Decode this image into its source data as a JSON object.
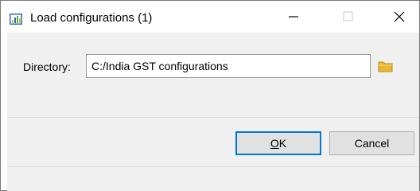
{
  "window": {
    "title": "Load configurations (1)",
    "icon": "app-icon"
  },
  "titlebar_buttons": {
    "minimize": "minimize-icon",
    "maximize": "maximize-icon",
    "close": "close-icon"
  },
  "form": {
    "directory_label": "Directory:",
    "directory_value": "C:/India GST configurations",
    "browse_icon": "folder-icon"
  },
  "buttons": {
    "ok_access_key": "O",
    "ok_rest": "K",
    "cancel_label": "Cancel"
  },
  "colors": {
    "accent": "#0078d7",
    "dialog_background": "#f0f0f0",
    "folder_yellow": "#e8b931"
  }
}
